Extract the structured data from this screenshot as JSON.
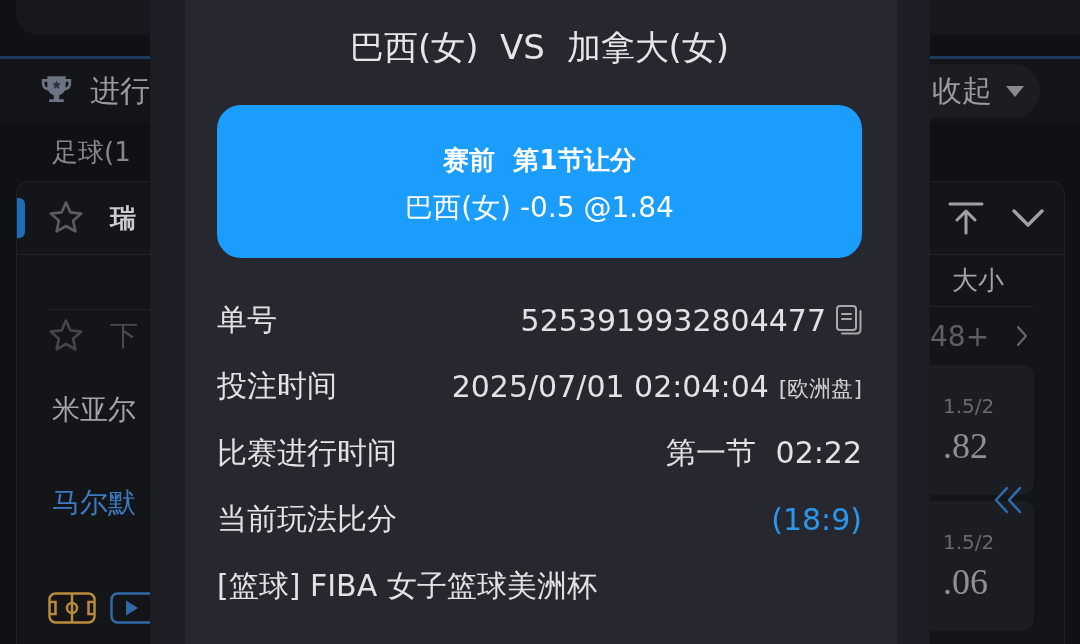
{
  "background": {
    "left": {
      "section_title": "进行",
      "sport_filter": "足球(1",
      "league": {
        "name": "瑞",
        "starred": false
      },
      "match": {
        "status": "下",
        "starred": false,
        "teams": [
          {
            "name": "米亚尔",
            "highlighted": false
          },
          {
            "name": "马尔默",
            "highlighted": true
          }
        ]
      }
    },
    "right": {
      "collapse_label": "收起",
      "market_header": "大小",
      "more_count": "48+",
      "odds": [
        {
          "line": "1.5/2",
          "price": ".82"
        },
        {
          "line": "1.5/2",
          "price": ".06"
        }
      ]
    }
  },
  "dialog": {
    "title": "巴西(女)  VS  加拿大(女)",
    "bet_card": {
      "market": "赛前  第1节让分",
      "selection": "巴西(女) -0.5 @1.84"
    },
    "details": [
      {
        "kind": "copy",
        "label": "单号",
        "value": "5253919932804477"
      },
      {
        "kind": "tagged",
        "label": "投注时间",
        "value": "2025/07/01 02:04:04",
        "tag": "[欧洲盘]"
      },
      {
        "kind": "plain",
        "label": "比赛进行时间",
        "value": "第一节  02:22"
      },
      {
        "kind": "score",
        "label": "当前玩法比分",
        "value": "(18:9)"
      }
    ],
    "league": "[篮球] FIBA 女子篮球美洲杯"
  }
}
